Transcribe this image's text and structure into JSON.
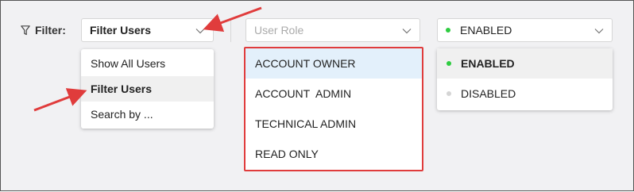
{
  "filter": {
    "label": "Filter:",
    "icon": "funnel-icon"
  },
  "filter_select": {
    "value": "Filter Users",
    "options": [
      "Show All Users",
      "Filter Users",
      "Search by ..."
    ],
    "selected_index": 1
  },
  "role_select": {
    "placeholder": "User Role",
    "options": [
      "ACCOUNT OWNER",
      "ACCOUNT  ADMIN",
      "TECHNICAL ADMIN",
      "READ ONLY"
    ],
    "highlighted_index": 0
  },
  "status_select": {
    "value": "ENABLED",
    "options": [
      "ENABLED",
      "DISABLED"
    ],
    "selected_index": 0
  },
  "colors": {
    "annotation_red": "#e03c3c",
    "enabled_dot": "#2ecc40",
    "disabled_dot": "#d5d5d5",
    "highlight_bg": "#e3f0fb"
  }
}
